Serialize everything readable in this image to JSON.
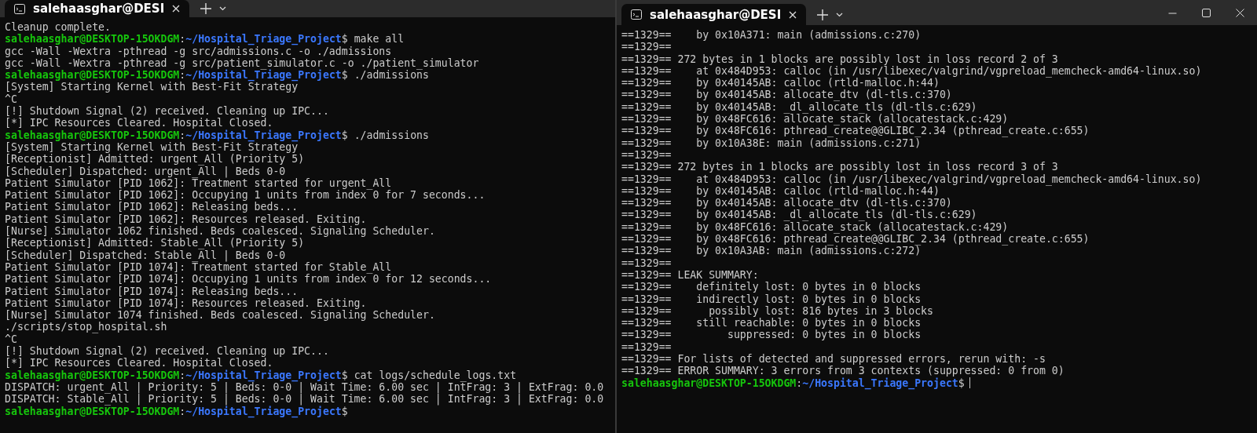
{
  "windows": [
    {
      "tab_title": "salehaasghar@DESI",
      "window_controls": false,
      "lines": [
        {
          "kind": "output",
          "text": "Cleanup complete."
        },
        {
          "kind": "prompt",
          "user": "salehaasghar@DESKTOP-15OKDGM",
          "separator": ":",
          "path": "~/Hospital_Triage_Project",
          "symbol": "$",
          "command": "make all",
          "cursor": false
        },
        {
          "kind": "output",
          "text": "gcc -Wall -Wextra -pthread -g src/admissions.c -o ./admissions"
        },
        {
          "kind": "output",
          "text": "gcc -Wall -Wextra -pthread -g src/patient_simulator.c -o ./patient_simulator"
        },
        {
          "kind": "prompt",
          "user": "salehaasghar@DESKTOP-15OKDGM",
          "separator": ":",
          "path": "~/Hospital_Triage_Project",
          "symbol": "$",
          "command": "./admissions",
          "cursor": false
        },
        {
          "kind": "output",
          "text": "[System] Starting Kernel with Best-Fit Strategy"
        },
        {
          "kind": "output",
          "text": "^C"
        },
        {
          "kind": "output",
          "text": "[!] Shutdown Signal (2) received. Cleaning up IPC..."
        },
        {
          "kind": "output",
          "text": "[*] IPC Resources Cleared. Hospital Closed."
        },
        {
          "kind": "prompt",
          "user": "salehaasghar@DESKTOP-15OKDGM",
          "separator": ":",
          "path": "~/Hospital_Triage_Project",
          "symbol": "$",
          "command": "./admissions",
          "cursor": false
        },
        {
          "kind": "output",
          "text": "[System] Starting Kernel with Best-Fit Strategy"
        },
        {
          "kind": "output",
          "text": "[Receptionist] Admitted: urgent_All (Priority 5)"
        },
        {
          "kind": "output",
          "text": "[Scheduler] Dispatched: urgent_All | Beds 0-0"
        },
        {
          "kind": "output",
          "text": "Patient Simulator [PID 1062]: Treatment started for urgent_All"
        },
        {
          "kind": "output",
          "text": "Patient Simulator [PID 1062]: Occupying 1 units from index 0 for 7 seconds..."
        },
        {
          "kind": "output",
          "text": "Patient Simulator [PID 1062]: Releasing beds..."
        },
        {
          "kind": "output",
          "text": "Patient Simulator [PID 1062]: Resources released. Exiting."
        },
        {
          "kind": "output",
          "text": "[Nurse] Simulator 1062 finished. Beds coalesced. Signaling Scheduler."
        },
        {
          "kind": "output",
          "text": "[Receptionist] Admitted: Stable_All (Priority 5)"
        },
        {
          "kind": "output",
          "text": "[Scheduler] Dispatched: Stable_All | Beds 0-0"
        },
        {
          "kind": "output",
          "text": "Patient Simulator [PID 1074]: Treatment started for Stable_All"
        },
        {
          "kind": "output",
          "text": "Patient Simulator [PID 1074]: Occupying 1 units from index 0 for 12 seconds..."
        },
        {
          "kind": "output",
          "text": "Patient Simulator [PID 1074]: Releasing beds..."
        },
        {
          "kind": "output",
          "text": "Patient Simulator [PID 1074]: Resources released. Exiting."
        },
        {
          "kind": "output",
          "text": "[Nurse] Simulator 1074 finished. Beds coalesced. Signaling Scheduler."
        },
        {
          "kind": "output",
          "text": "./scripts/stop_hospital.sh"
        },
        {
          "kind": "output",
          "text": "^C"
        },
        {
          "kind": "output",
          "text": "[!] Shutdown Signal (2) received. Cleaning up IPC..."
        },
        {
          "kind": "output",
          "text": "[*] IPC Resources Cleared. Hospital Closed."
        },
        {
          "kind": "prompt",
          "user": "salehaasghar@DESKTOP-15OKDGM",
          "separator": ":",
          "path": "~/Hospital_Triage_Project",
          "symbol": "$",
          "command": "cat logs/schedule_logs.txt",
          "cursor": false
        },
        {
          "kind": "output",
          "text": "DISPATCH: urgent_All | Priority: 5 | Beds: 0-0 | Wait Time: 6.00 sec | IntFrag: 3 | ExtFrag: 0.0"
        },
        {
          "kind": "output",
          "text": "DISPATCH: Stable_All | Priority: 5 | Beds: 0-0 | Wait Time: 6.00 sec | IntFrag: 3 | ExtFrag: 0.0"
        },
        {
          "kind": "prompt",
          "user": "salehaasghar@DESKTOP-15OKDGM",
          "separator": ":",
          "path": "~/Hospital_Triage_Project",
          "symbol": "$",
          "cursor": false
        }
      ]
    },
    {
      "tab_title": "salehaasghar@DESI",
      "window_controls": true,
      "lines": [
        {
          "kind": "output",
          "text": "==1329==    by 0x10A371: main (admissions.c:270)"
        },
        {
          "kind": "output",
          "text": "==1329=="
        },
        {
          "kind": "output",
          "text": "==1329== 272 bytes in 1 blocks are possibly lost in loss record 2 of 3"
        },
        {
          "kind": "output",
          "text": "==1329==    at 0x484D953: calloc (in /usr/libexec/valgrind/vgpreload_memcheck-amd64-linux.so)"
        },
        {
          "kind": "output",
          "text": "==1329==    by 0x40145AB: calloc (rtld-malloc.h:44)"
        },
        {
          "kind": "output",
          "text": "==1329==    by 0x40145AB: allocate_dtv (dl-tls.c:370)"
        },
        {
          "kind": "output",
          "text": "==1329==    by 0x40145AB: _dl_allocate_tls (dl-tls.c:629)"
        },
        {
          "kind": "output",
          "text": "==1329==    by 0x48FC616: allocate_stack (allocatestack.c:429)"
        },
        {
          "kind": "output",
          "text": "==1329==    by 0x48FC616: pthread_create@@GLIBC_2.34 (pthread_create.c:655)"
        },
        {
          "kind": "output",
          "text": "==1329==    by 0x10A38E: main (admissions.c:271)"
        },
        {
          "kind": "output",
          "text": "==1329=="
        },
        {
          "kind": "output",
          "text": "==1329== 272 bytes in 1 blocks are possibly lost in loss record 3 of 3"
        },
        {
          "kind": "output",
          "text": "==1329==    at 0x484D953: calloc (in /usr/libexec/valgrind/vgpreload_memcheck-amd64-linux.so)"
        },
        {
          "kind": "output",
          "text": "==1329==    by 0x40145AB: calloc (rtld-malloc.h:44)"
        },
        {
          "kind": "output",
          "text": "==1329==    by 0x40145AB: allocate_dtv (dl-tls.c:370)"
        },
        {
          "kind": "output",
          "text": "==1329==    by 0x40145AB: _dl_allocate_tls (dl-tls.c:629)"
        },
        {
          "kind": "output",
          "text": "==1329==    by 0x48FC616: allocate_stack (allocatestack.c:429)"
        },
        {
          "kind": "output",
          "text": "==1329==    by 0x48FC616: pthread_create@@GLIBC_2.34 (pthread_create.c:655)"
        },
        {
          "kind": "output",
          "text": "==1329==    by 0x10A3AB: main (admissions.c:272)"
        },
        {
          "kind": "output",
          "text": "==1329=="
        },
        {
          "kind": "output",
          "text": "==1329== LEAK SUMMARY:"
        },
        {
          "kind": "output",
          "text": "==1329==    definitely lost: 0 bytes in 0 blocks"
        },
        {
          "kind": "output",
          "text": "==1329==    indirectly lost: 0 bytes in 0 blocks"
        },
        {
          "kind": "output",
          "text": "==1329==      possibly lost: 816 bytes in 3 blocks"
        },
        {
          "kind": "output",
          "text": "==1329==    still reachable: 0 bytes in 0 blocks"
        },
        {
          "kind": "output",
          "text": "==1329==         suppressed: 0 bytes in 0 blocks"
        },
        {
          "kind": "output",
          "text": "==1329=="
        },
        {
          "kind": "output",
          "text": "==1329== For lists of detected and suppressed errors, rerun with: -s"
        },
        {
          "kind": "output",
          "text": "==1329== ERROR SUMMARY: 3 errors from 3 contexts (suppressed: 0 from 0)"
        },
        {
          "kind": "prompt",
          "user": "salehaasghar@DESKTOP-15OKDGM",
          "separator": ":",
          "path": "~/Hospital_Triage_Project",
          "symbol": "$",
          "cursor": true
        }
      ]
    }
  ]
}
